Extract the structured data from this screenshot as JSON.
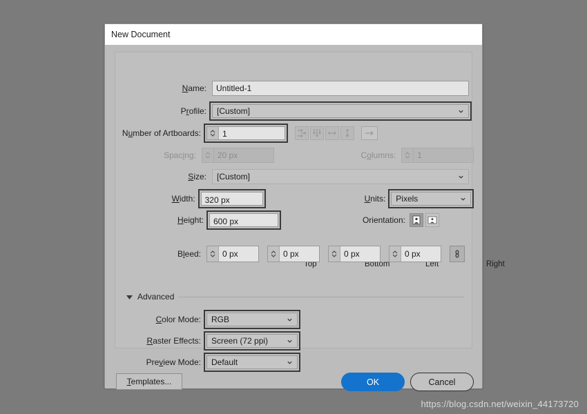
{
  "window": {
    "title": "New Document",
    "background_color": "#7b7b7b",
    "dialog_color": "#bcbcbc",
    "accent_color": "#1473cc"
  },
  "fields": {
    "name": {
      "label": "Name:",
      "value": "Untitled-1"
    },
    "profile": {
      "label": "Profile:",
      "value": "[Custom]"
    },
    "artboards": {
      "label": "Number of Artboards:",
      "value": "1"
    },
    "spacing": {
      "label": "Spacing:",
      "value": "20 px"
    },
    "columns": {
      "label": "Columns:",
      "value": "1"
    },
    "size": {
      "label": "Size:",
      "value": "[Custom]"
    },
    "width": {
      "label": "Width:",
      "value": "320 px"
    },
    "height": {
      "label": "Height:",
      "value": "600 px"
    },
    "units": {
      "label": "Units:",
      "value": "Pixels"
    },
    "orientation": {
      "label": "Orientation:"
    },
    "bleed": {
      "label": "Bleed:",
      "headers": [
        "Top",
        "Bottom",
        "Left",
        "Right"
      ],
      "values": [
        "0 px",
        "0 px",
        "0 px",
        "0 px"
      ]
    }
  },
  "advanced": {
    "label": "Advanced",
    "color_mode": {
      "label": "Color Mode:",
      "value": "RGB"
    },
    "raster_effects": {
      "label": "Raster Effects:",
      "value": "Screen (72 ppi)"
    },
    "preview_mode": {
      "label": "Preview Mode:",
      "value": "Default"
    }
  },
  "footer": {
    "templates": "Templates...",
    "ok": "OK",
    "cancel": "Cancel"
  },
  "watermark": "https://blog.csdn.net/weixin_44173720"
}
